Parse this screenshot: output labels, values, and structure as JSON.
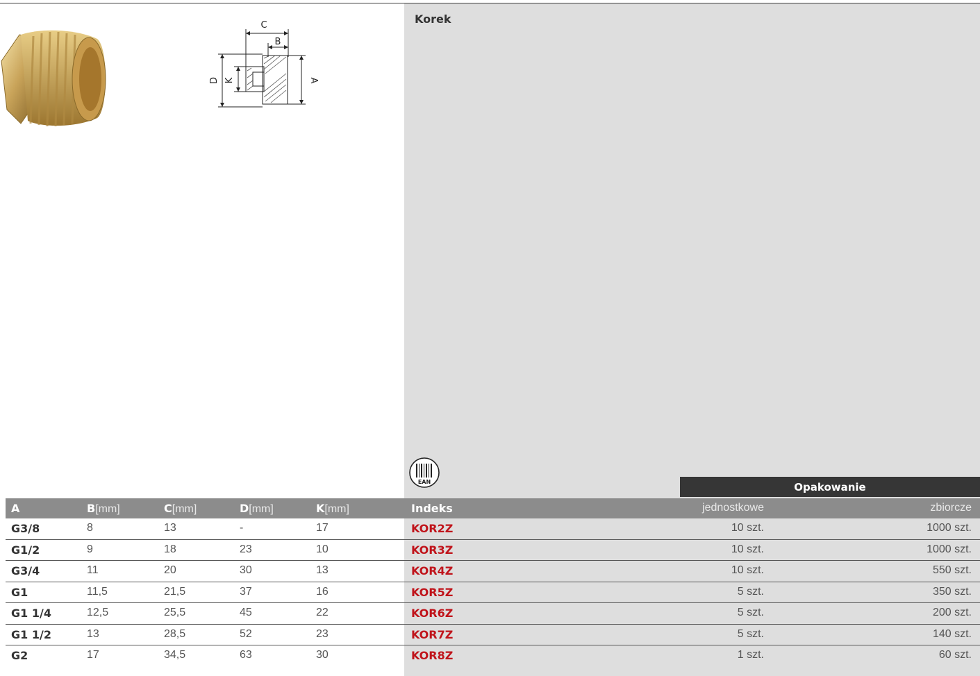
{
  "product": {
    "title": "Korek"
  },
  "drawing": {
    "labels": {
      "c": "C",
      "b": "B",
      "d": "D",
      "k": "K",
      "a": "A"
    }
  },
  "ean_icon": {
    "label": "EAN"
  },
  "packaging": {
    "header": "Opakowanie",
    "unit_label": "jednostkowe",
    "bulk_label": "zbiorcze"
  },
  "table": {
    "columns": {
      "a": "A",
      "b": "B",
      "c": "C",
      "d": "D",
      "k": "K",
      "unit": "[mm]",
      "index": "Indeks"
    },
    "rows": [
      {
        "a": "G3/8",
        "b": "8",
        "c": "13",
        "d": "-",
        "k": "17",
        "index": "KOR2Z",
        "unit_pack": "10 szt.",
        "bulk_pack": "1000 szt."
      },
      {
        "a": "G1/2",
        "b": "9",
        "c": "18",
        "d": "23",
        "k": "10",
        "index": "KOR3Z",
        "unit_pack": "10 szt.",
        "bulk_pack": "1000 szt."
      },
      {
        "a": "G3/4",
        "b": "11",
        "c": "20",
        "d": "30",
        "k": "13",
        "index": "KOR4Z",
        "unit_pack": "10 szt.",
        "bulk_pack": "550 szt."
      },
      {
        "a": "G1",
        "b": "11,5",
        "c": "21,5",
        "d": "37",
        "k": "16",
        "index": "KOR5Z",
        "unit_pack": "5 szt.",
        "bulk_pack": "350 szt."
      },
      {
        "a": "G1 1/4",
        "b": "12,5",
        "c": "25,5",
        "d": "45",
        "k": "22",
        "index": "KOR6Z",
        "unit_pack": "5 szt.",
        "bulk_pack": "200 szt."
      },
      {
        "a": "G1 1/2",
        "b": "13",
        "c": "28,5",
        "d": "52",
        "k": "23",
        "index": "KOR7Z",
        "unit_pack": "5 szt.",
        "bulk_pack": "140 szt."
      },
      {
        "a": "G2",
        "b": "17",
        "c": "34,5",
        "d": "63",
        "k": "30",
        "index": "KOR8Z",
        "unit_pack": "1 szt.",
        "bulk_pack": "60 szt."
      }
    ]
  },
  "colors": {
    "index_red": "#c0141b",
    "header_gray": "#8c8c8c",
    "panel_gray": "#dedede",
    "dark": "#363636"
  }
}
